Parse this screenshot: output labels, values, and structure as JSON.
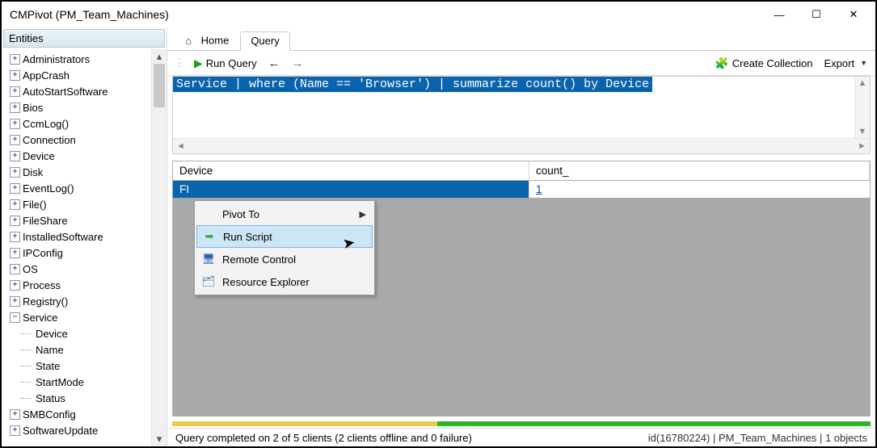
{
  "window": {
    "title": "CMPivot (PM_Team_Machines)"
  },
  "sidebar": {
    "header": "Entities",
    "items": [
      {
        "label": "Administrators",
        "exp": "plus"
      },
      {
        "label": "AppCrash",
        "exp": "plus"
      },
      {
        "label": "AutoStartSoftware",
        "exp": "plus"
      },
      {
        "label": "Bios",
        "exp": "plus"
      },
      {
        "label": "CcmLog()",
        "exp": "plus"
      },
      {
        "label": "Connection",
        "exp": "plus"
      },
      {
        "label": "Device",
        "exp": "plus"
      },
      {
        "label": "Disk",
        "exp": "plus"
      },
      {
        "label": "EventLog()",
        "exp": "plus"
      },
      {
        "label": "File()",
        "exp": "plus"
      },
      {
        "label": "FileShare",
        "exp": "plus"
      },
      {
        "label": "InstalledSoftware",
        "exp": "plus"
      },
      {
        "label": "IPConfig",
        "exp": "plus"
      },
      {
        "label": "OS",
        "exp": "plus"
      },
      {
        "label": "Process",
        "exp": "plus"
      },
      {
        "label": "Registry()",
        "exp": "plus"
      },
      {
        "label": "Service",
        "exp": "minus",
        "children": [
          "Device",
          "Name",
          "State",
          "StartMode",
          "Status"
        ]
      },
      {
        "label": "SMBConfig",
        "exp": "plus"
      },
      {
        "label": "SoftwareUpdate",
        "exp": "plus"
      }
    ]
  },
  "tabs": {
    "home": "Home",
    "query": "Query"
  },
  "toolbar": {
    "run": "Run Query",
    "create_collection": "Create Collection",
    "export": "Export"
  },
  "query": {
    "text": "Service | where (Name == 'Browser') | summarize count() by Device"
  },
  "grid": {
    "col1": "Device",
    "col2": "count_",
    "row1_device": "FI",
    "row1_count": "1"
  },
  "context_menu": {
    "pivot": "Pivot To",
    "run_script": "Run Script",
    "remote": "Remote Control",
    "explorer": "Resource Explorer"
  },
  "progress": {
    "done_pct": 62,
    "pending_pct": 38
  },
  "status": {
    "left": "Query completed on 2 of 5 clients (2 clients offline and 0 failure)",
    "right": "id(16780224)  |  PM_Team_Machines  |  1 objects"
  }
}
